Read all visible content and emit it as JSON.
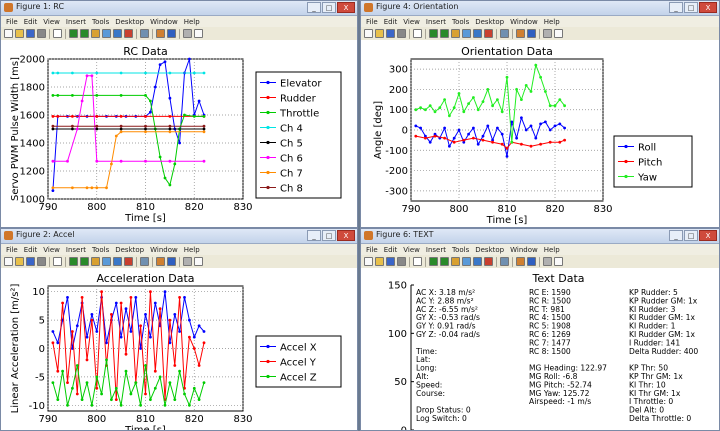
{
  "menu": [
    "File",
    "Edit",
    "View",
    "Insert",
    "Tools",
    "Desktop",
    "Window",
    "Help"
  ],
  "windows": {
    "rc": {
      "title": "Figure 1: RC"
    },
    "orientation": {
      "title": "Figure 4: Orientation"
    },
    "accel": {
      "title": "Figure 2: Accel"
    },
    "text": {
      "title": "Figure 6: TEXT"
    }
  },
  "window_buttons": {
    "minimize": "_",
    "maximize": "□",
    "close": "X"
  },
  "toolbar_icons": [
    "new-figure-icon",
    "open-file-icon",
    "save-icon",
    "print-icon",
    "sep",
    "pointer-icon",
    "sep",
    "zoom-in-icon",
    "zoom-out-icon",
    "pan-icon",
    "rotate-icon",
    "data-cursor-icon",
    "brush-icon",
    "sep",
    "link-icon",
    "sep",
    "colorbar-icon",
    "legend-icon",
    "sep",
    "hide-plot-tools-icon",
    "show-plot-tools-icon"
  ],
  "colors": {
    "blue": "#0000ff",
    "red": "#ff0000",
    "green": "#00cc00",
    "cyan": "#00e5e5",
    "black": "#000000",
    "magenta": "#ff00ff",
    "orange": "#ff8c00",
    "brown": "#8b1a1a",
    "pink": "#ff44ff",
    "lime": "#22ee22"
  },
  "chart_data": [
    {
      "type": "line",
      "title": "RC Data",
      "xlabel": "Time [s]",
      "ylabel": "Servo PWM Pulse Width [ms]",
      "xlim": [
        790,
        830
      ],
      "ylim": [
        1000,
        2000
      ],
      "xticks": [
        "790",
        "800",
        "810",
        "820",
        "830"
      ],
      "yticks": [
        "1000",
        "1200",
        "1400",
        "1600",
        "1800",
        "2000"
      ],
      "grid": true,
      "legend_position": "right",
      "series": [
        {
          "name": "Elevator",
          "color": "#0000ff",
          "x": [
            791,
            792,
            794,
            796,
            798,
            800,
            802,
            804,
            806,
            808,
            810,
            811,
            812,
            813,
            814,
            815,
            816,
            817,
            818,
            819,
            820,
            821,
            822
          ],
          "y": [
            1060,
            1590,
            1590,
            1590,
            1590,
            1590,
            1590,
            1590,
            1590,
            1590,
            1590,
            1620,
            1800,
            1960,
            1980,
            1720,
            1500,
            1400,
            1900,
            2000,
            1600,
            1700,
            1600
          ]
        },
        {
          "name": "Rudder",
          "color": "#ff0000",
          "x": [
            791,
            792,
            795,
            800,
            805,
            810,
            815,
            822
          ],
          "y": [
            1590,
            1590,
            1590,
            1590,
            1590,
            1590,
            1590,
            1590
          ]
        },
        {
          "name": "Throttle",
          "color": "#00cc00",
          "x": [
            791,
            792,
            795,
            800,
            805,
            810,
            811,
            812,
            813,
            814,
            815,
            816,
            817,
            818,
            820,
            822
          ],
          "y": [
            1740,
            1740,
            1740,
            1740,
            1740,
            1740,
            1700,
            1500,
            1300,
            1150,
            1100,
            1250,
            1500,
            1600,
            1590,
            1590
          ]
        },
        {
          "name": "Ch 4",
          "color": "#00e5e5",
          "x": [
            791,
            792,
            795,
            800,
            805,
            810,
            815,
            820,
            822
          ],
          "y": [
            1900,
            1900,
            1900,
            1900,
            1900,
            1900,
            1900,
            1900,
            1900
          ]
        },
        {
          "name": "Ch 5",
          "color": "#000000",
          "x": [
            791,
            795,
            800,
            805,
            810,
            815,
            822
          ],
          "y": [
            1500,
            1500,
            1500,
            1500,
            1500,
            1500,
            1500
          ]
        },
        {
          "name": "Ch 6",
          "color": "#ff00ff",
          "x": [
            791,
            794,
            796,
            797,
            798,
            799,
            800,
            805,
            810,
            815,
            822
          ],
          "y": [
            1270,
            1270,
            1500,
            1700,
            1880,
            1880,
            1270,
            1270,
            1270,
            1270,
            1270
          ]
        },
        {
          "name": "Ch 7",
          "color": "#ff8c00",
          "x": [
            791,
            795,
            798,
            799,
            800,
            802,
            803,
            804,
            805,
            810,
            815,
            822
          ],
          "y": [
            1080,
            1080,
            1080,
            1080,
            1080,
            1080,
            1250,
            1450,
            1480,
            1480,
            1480,
            1480
          ]
        },
        {
          "name": "Ch 8",
          "color": "#8b1a1a",
          "x": [
            791,
            795,
            800,
            805,
            810,
            815,
            822
          ],
          "y": [
            1520,
            1520,
            1520,
            1520,
            1520,
            1520,
            1520
          ]
        }
      ]
    },
    {
      "type": "line",
      "title": "Orientation Data",
      "xlabel": "Time [s]",
      "ylabel": "Angle [deg]",
      "xlim": [
        790,
        830
      ],
      "ylim": [
        -350,
        350
      ],
      "xticks": [
        "790",
        "800",
        "810",
        "820",
        "830"
      ],
      "yticks": [
        "-300",
        "-200",
        "-100",
        "0",
        "100",
        "200",
        "300"
      ],
      "grid": true,
      "legend_position": "right",
      "series": [
        {
          "name": "Roll",
          "color": "#0000ff",
          "x": [
            791,
            792,
            793,
            794,
            795,
            796,
            797,
            798,
            799,
            800,
            801,
            802,
            803,
            804,
            805,
            806,
            807,
            808,
            809,
            810,
            811,
            812,
            813,
            814,
            815,
            816,
            817,
            818,
            819,
            820,
            821,
            822
          ],
          "y": [
            20,
            10,
            -30,
            -60,
            -20,
            -40,
            10,
            -80,
            -40,
            0,
            -60,
            -20,
            10,
            -70,
            -30,
            20,
            -50,
            10,
            -20,
            -130,
            40,
            -40,
            60,
            0,
            20,
            -40,
            30,
            40,
            0,
            20,
            30,
            10
          ]
        },
        {
          "name": "Pitch",
          "color": "#ff0000",
          "x": [
            791,
            793,
            795,
            797,
            799,
            801,
            803,
            805,
            807,
            809,
            810,
            811,
            813,
            815,
            817,
            819,
            821,
            822
          ],
          "y": [
            -30,
            -40,
            -30,
            -40,
            -60,
            -50,
            -40,
            -50,
            -60,
            -70,
            -90,
            -60,
            -70,
            -80,
            -70,
            -60,
            -60,
            -50
          ]
        },
        {
          "name": "Yaw",
          "color": "#22ee22",
          "x": [
            791,
            792,
            793,
            794,
            795,
            796,
            797,
            798,
            799,
            800,
            801,
            802,
            803,
            804,
            805,
            806,
            807,
            808,
            809,
            810,
            811,
            812,
            813,
            814,
            815,
            816,
            817,
            818,
            819,
            820,
            821,
            822
          ],
          "y": [
            100,
            110,
            100,
            120,
            90,
            110,
            150,
            70,
            110,
            180,
            90,
            130,
            160,
            100,
            140,
            200,
            120,
            150,
            90,
            260,
            -60,
            200,
            150,
            220,
            190,
            320,
            260,
            190,
            120,
            120,
            150,
            120
          ]
        }
      ]
    },
    {
      "type": "line",
      "title": "Acceleration Data",
      "xlabel": "Time [s]",
      "ylabel": "Linear Acceleration [m/s²]",
      "xlim": [
        790,
        830
      ],
      "ylim": [
        -11,
        11
      ],
      "xticks": [
        "790",
        "800",
        "810",
        "820",
        "830"
      ],
      "yticks": [
        "-10",
        "-5",
        "0",
        "5",
        "10"
      ],
      "grid": true,
      "legend_position": "right",
      "series": [
        {
          "name": "Accel X",
          "color": "#0000ff",
          "x": [
            791,
            792,
            793,
            794,
            795,
            796,
            797,
            798,
            799,
            800,
            801,
            802,
            803,
            804,
            805,
            806,
            807,
            808,
            809,
            810,
            811,
            812,
            813,
            814,
            815,
            816,
            817,
            818,
            819,
            820,
            821,
            822
          ],
          "y": [
            3,
            1,
            5,
            9,
            0,
            4,
            8,
            2,
            6,
            3,
            9,
            1,
            5,
            8,
            2,
            7,
            3,
            9,
            0,
            6,
            2,
            8,
            4,
            10,
            1,
            6,
            3,
            9,
            5,
            2,
            4,
            3
          ]
        },
        {
          "name": "Accel Y",
          "color": "#ff0000",
          "x": [
            791,
            792,
            793,
            794,
            795,
            796,
            797,
            798,
            799,
            800,
            801,
            802,
            803,
            804,
            805,
            806,
            807,
            808,
            809,
            810,
            811,
            812,
            813,
            814,
            815,
            816,
            817,
            818,
            819,
            820,
            821,
            822
          ],
          "y": [
            1,
            -4,
            8,
            -6,
            3,
            -8,
            9,
            -2,
            5,
            -7,
            10,
            -3,
            6,
            -9,
            8,
            -1,
            9,
            -6,
            4,
            -8,
            10,
            -4,
            7,
            -9,
            5,
            -3,
            9,
            -7,
            2,
            0,
            -3,
            1
          ]
        },
        {
          "name": "Accel Z",
          "color": "#00cc00",
          "x": [
            791,
            792,
            793,
            794,
            795,
            796,
            797,
            798,
            799,
            800,
            801,
            802,
            803,
            804,
            805,
            806,
            807,
            808,
            809,
            810,
            811,
            812,
            813,
            814,
            815,
            816,
            817,
            818,
            819,
            820,
            821,
            822
          ],
          "y": [
            -6,
            -9,
            -4,
            -10,
            -7,
            -3,
            -9,
            -6,
            -10,
            -5,
            -8,
            -2,
            -9,
            -7,
            -10,
            -4,
            -8,
            -6,
            -10,
            -3,
            -9,
            -7,
            -5,
            -10,
            -6,
            -9,
            -4,
            -8,
            -10,
            -7,
            -9,
            -6
          ]
        }
      ]
    }
  ],
  "text_panel": {
    "title": "Text Data",
    "yticks": [
      "0",
      "50",
      "100",
      "150"
    ],
    "col1": [
      "AC X: 3.18 m/s²",
      "AC Y: 2.88 m/s²",
      "AC Z: -6.55 m/s²",
      "GY X: -0.53 rad/s",
      "GY Y: 0.91 rad/s",
      "GY Z: -0.04 rad/s",
      "",
      "Time:",
      "Lat:",
      "Long:",
      "Alt:",
      "Speed:",
      "Course:",
      "",
      "Drop Status: 0",
      "Log Switch: 0"
    ],
    "col2": [
      "RC E: 1590",
      "RC R: 1500",
      "RC T: 981",
      "RC 4: 1500",
      "RC 5: 1908",
      "RC 6: 1269",
      "RC 7: 1477",
      "RC 8: 1500",
      "",
      "MG Heading: 122.97",
      "MG Roll: -6.8",
      "MG Pitch: -52.74",
      "MG Yaw: 125.72",
      "Airspeed: -1 m/s"
    ],
    "col3": [
      "KP Rudder: 5",
      "KP Rudder GM: 1x",
      "KI Rudder: 3",
      "KI Rudder GM: 1x",
      "KI Rudder: 1",
      "KI Rudder GM: 1x",
      "I Rudder: 141",
      "Delta Rudder: 400",
      "",
      "KP Thr: 50",
      "KP Thr GM: 1x",
      "KI Thr: 10",
      "KI Thr GM: 1x",
      "I Throttle: 0",
      "Del Alt: 0",
      "Delta Throttle: 0"
    ]
  }
}
